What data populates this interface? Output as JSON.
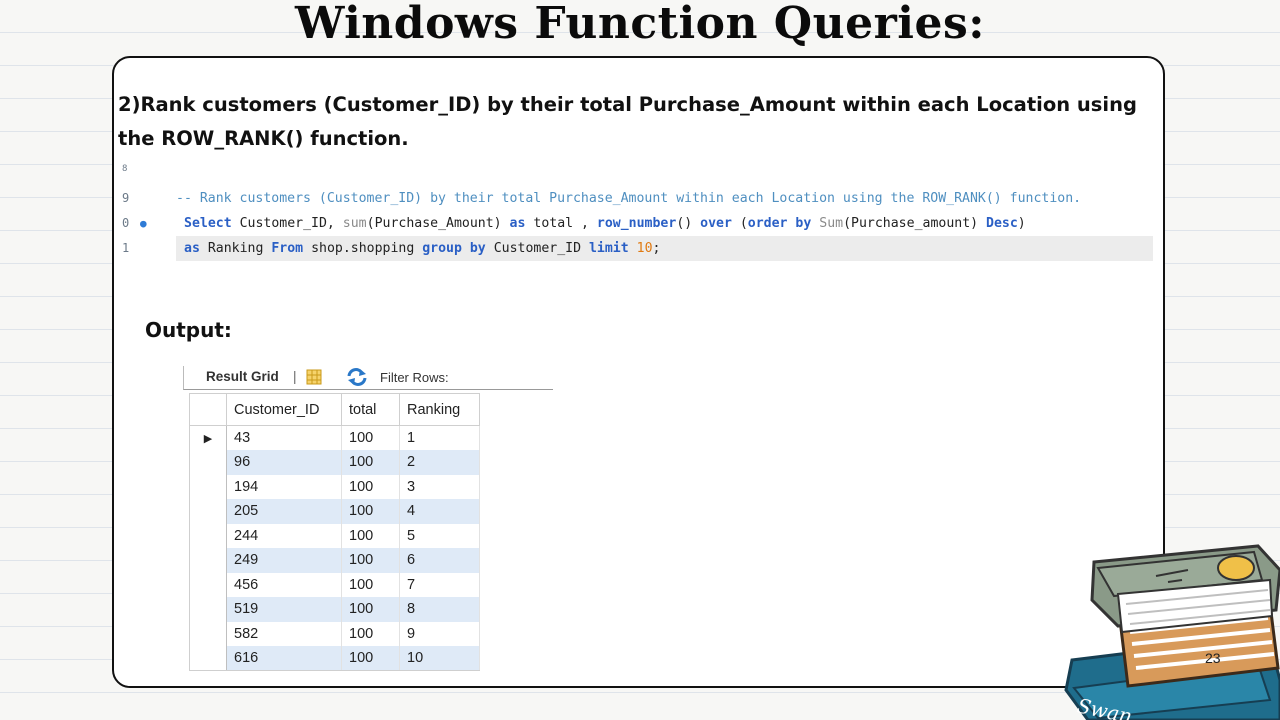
{
  "slide": {
    "title": "Windows Function Queries:",
    "question": "2)Rank customers (Customer_ID) by their total Purchase_Amount within each Location using the ROW_RANK() function.",
    "output_label": "Output:",
    "page_number": "23"
  },
  "code": {
    "line_numbers": [
      "8",
      "9",
      "0",
      "1"
    ],
    "comment": "-- Rank customers (Customer_ID) by their total Purchase_Amount within each Location using the ROW_RANK() function.",
    "line2": {
      "select": "Select",
      "p1": " Customer_ID, ",
      "sum": "sum",
      "p2": "(Purchase_Amount) ",
      "as": "as",
      "p3": " total , ",
      "row_number": "row_number",
      "p4": "() ",
      "over": "over",
      "p5": " (",
      "order_by": "order by",
      "p6": " ",
      "sum2": "Sum",
      "p7": "(Purchase_amount) ",
      "desc": "Desc",
      "p8": ")"
    },
    "line3": {
      "as": "as",
      "p1": " Ranking ",
      "from": "From",
      "p2": " shop.shopping ",
      "group_by": "group by",
      "p3": " Customer_ID ",
      "limit": "limit",
      "p4": " ",
      "limit_value": "10",
      "p5": ";"
    }
  },
  "result_grid": {
    "toolbar": {
      "result_label": "Result Grid",
      "separator": "|",
      "filter_label": "Filter Rows:"
    },
    "columns": [
      "Customer_ID",
      "total",
      "Ranking"
    ],
    "rows": [
      [
        "43",
        "100",
        "1"
      ],
      [
        "96",
        "100",
        "2"
      ],
      [
        "194",
        "100",
        "3"
      ],
      [
        "205",
        "100",
        "4"
      ],
      [
        "244",
        "100",
        "5"
      ],
      [
        "249",
        "100",
        "6"
      ],
      [
        "456",
        "100",
        "7"
      ],
      [
        "519",
        "100",
        "8"
      ],
      [
        "582",
        "100",
        "9"
      ],
      [
        "616",
        "100",
        "10"
      ]
    ],
    "selected_row_marker": "▶"
  },
  "decoration": {
    "book_spine_text": "Swan"
  },
  "colors": {
    "keyword": "#2a5fc5",
    "comment": "#4f8fc0",
    "number": "#e07a12",
    "row_stripe": "#dfeaf7"
  }
}
